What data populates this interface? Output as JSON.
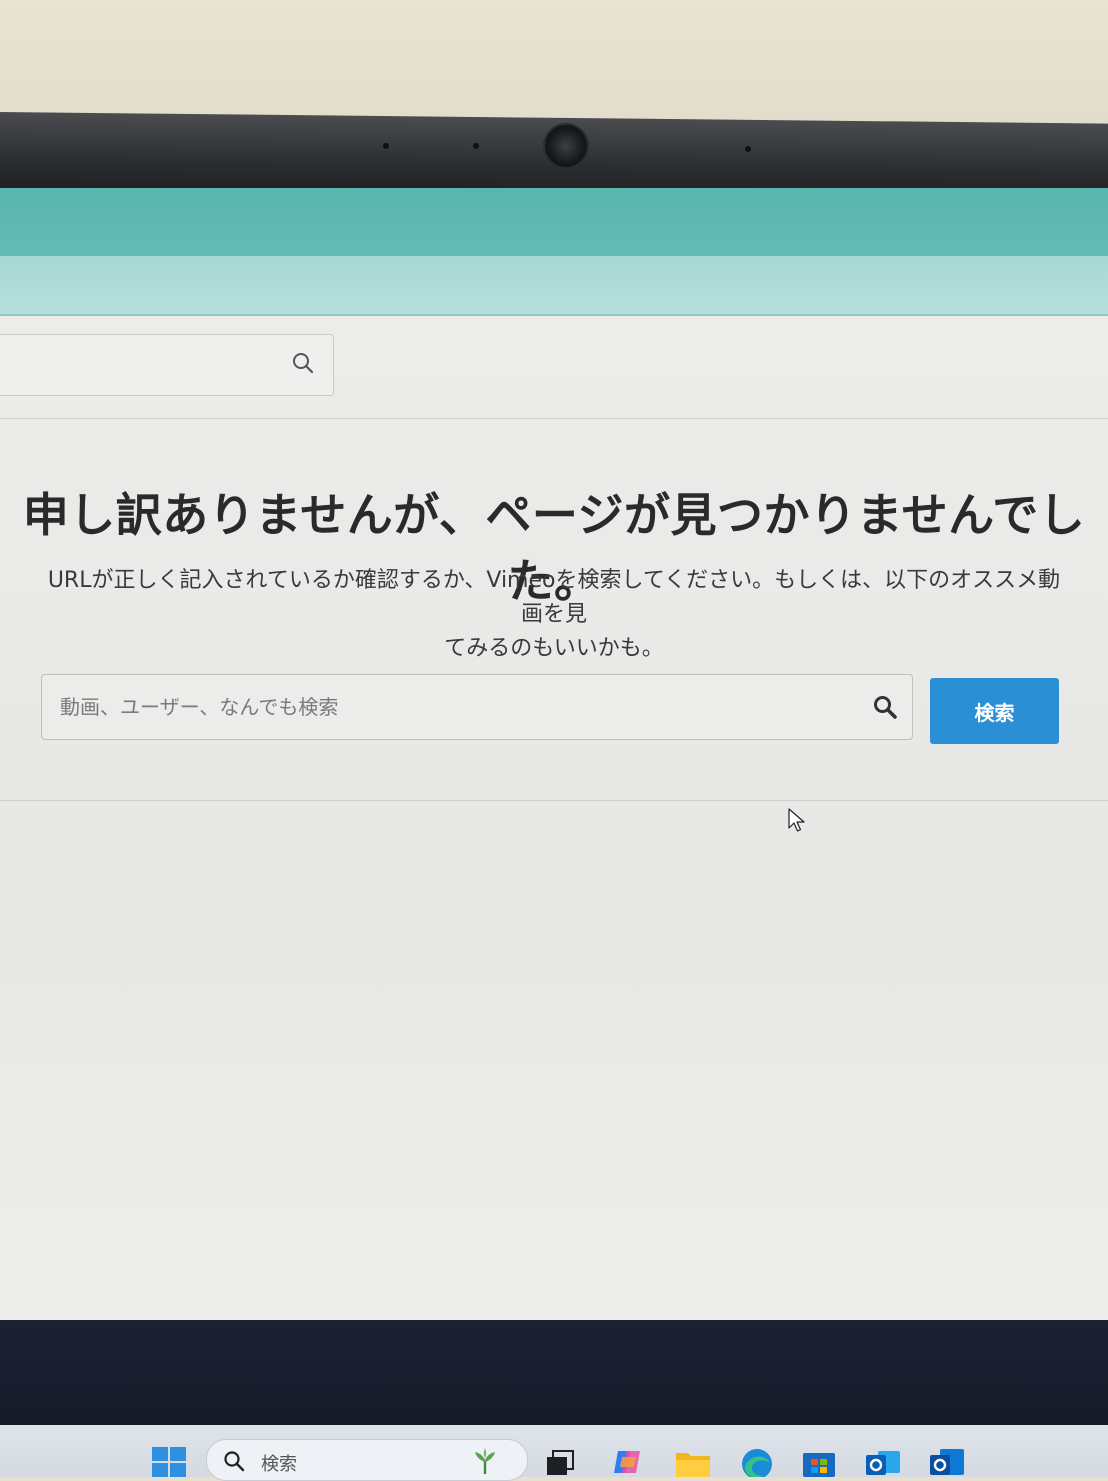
{
  "top_search": {
    "icon": "search-icon"
  },
  "error": {
    "title": "申し訳ありませんが、ページが見つかりませんでした。",
    "description_line1": "URLが正しく記入されているか確認するか、Vimeoを検索してください。もしくは、以下のオススメ動画を見",
    "description_line2": "てみるのもいいかも。"
  },
  "search": {
    "placeholder": "動画、ユーザー、なんでも検索",
    "button_label": "検索",
    "icon": "search-icon"
  },
  "taskbar": {
    "search_label": "検索",
    "apps": [
      "windows-start-icon",
      "search-icon",
      "widgets-plant-icon",
      "task-view-icon",
      "copilot-icon",
      "file-explorer-icon",
      "edge-icon",
      "store-icon",
      "outlook-icon",
      "outlook-classic-icon"
    ]
  },
  "colors": {
    "accent_button": "#2b8fd6",
    "browser_bar": "#5bb6b0",
    "page_bg": "#ececea"
  }
}
